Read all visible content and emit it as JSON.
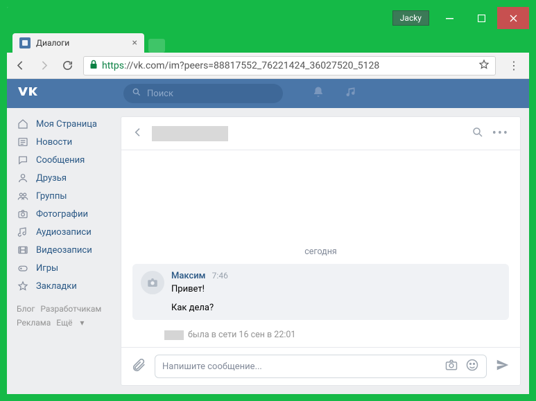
{
  "window": {
    "profile_name": "Jacky"
  },
  "tab": {
    "title": "Диалоги"
  },
  "addressbar": {
    "scheme": "https",
    "url_rest": "://vk.com/im?peers=88817552_76221424_36027520_5128"
  },
  "vk_header": {
    "search_placeholder": "Поиск"
  },
  "sidebar": {
    "items": [
      {
        "icon": "home",
        "label": "Моя Страница"
      },
      {
        "icon": "news",
        "label": "Новости"
      },
      {
        "icon": "messages",
        "label": "Сообщения"
      },
      {
        "icon": "friends",
        "label": "Друзья"
      },
      {
        "icon": "groups",
        "label": "Группы"
      },
      {
        "icon": "photos",
        "label": "Фотографии"
      },
      {
        "icon": "audio",
        "label": "Аудиозаписи"
      },
      {
        "icon": "video",
        "label": "Видеозаписи"
      },
      {
        "icon": "games",
        "label": "Игры"
      },
      {
        "icon": "bookmarks",
        "label": "Закладки"
      }
    ],
    "footer": {
      "blog": "Блог",
      "devs": "Разработчикам",
      "ads": "Реклама",
      "more": "Ещё"
    }
  },
  "chat": {
    "date_label": "сегодня",
    "message": {
      "author": "Максим",
      "time": "7:46",
      "line1": "Привет!",
      "line2": "Как дела?"
    },
    "last_seen": "была в сети 16 сен в 22:01",
    "composer_placeholder": "Напишите сообщение..."
  }
}
